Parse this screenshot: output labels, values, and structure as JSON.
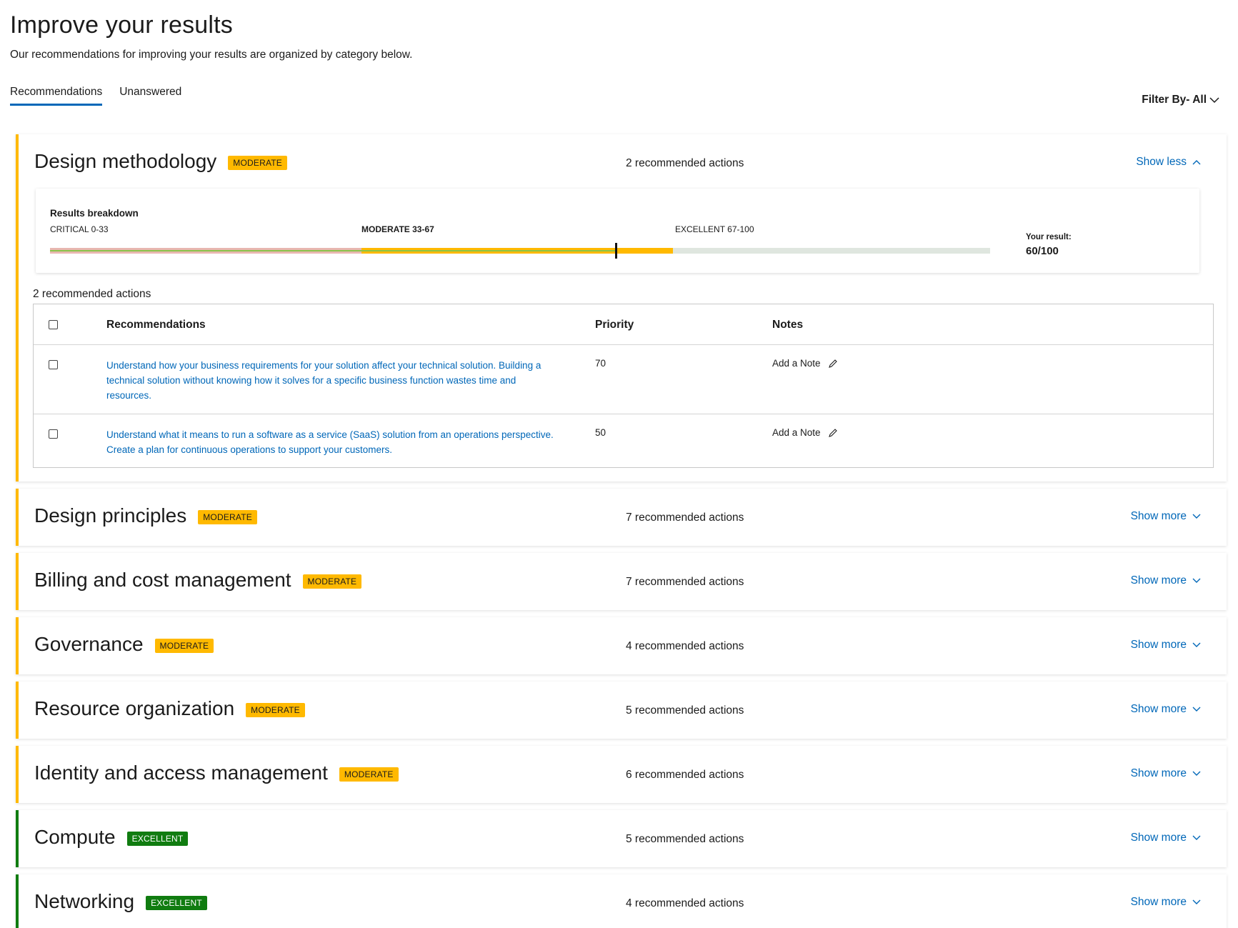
{
  "page": {
    "title": "Improve your results",
    "subtitle": "Our recommendations for improving your results are organized by category below."
  },
  "tabs": [
    {
      "label": "Recommendations",
      "active": true
    },
    {
      "label": "Unanswered",
      "active": false
    }
  ],
  "filter": {
    "label": "Filter By- All"
  },
  "colors": {
    "accent": "#0067b8",
    "moderate": "#ffb900",
    "excellent": "#107c10"
  },
  "categories": [
    {
      "name": "Design methodology",
      "badge": "MODERATE",
      "count": "2 recommended actions",
      "toggle": "Show less",
      "expanded": true,
      "breakdown": {
        "title": "Results breakdown",
        "ranges": [
          "CRITICAL 0-33",
          "MODERATE 33-67",
          "EXCELLENT 67-100"
        ],
        "result_label": "Your result:",
        "result_value": "60/100",
        "score": 60
      },
      "actions_label": "2 recommended actions",
      "table": {
        "headers": {
          "recommendations": "Recommendations",
          "priority": "Priority",
          "notes": "Notes"
        },
        "rows": [
          {
            "text": "Understand how your business requirements for your solution affect your technical solution. Building a technical solution without knowing how it solves for a specific business function wastes time and resources.",
            "priority": "70",
            "note": "Add a Note"
          },
          {
            "text": "Understand what it means to run a software as a service (SaaS) solution from an operations perspective. Create a plan for continuous operations to support your customers.",
            "priority": "50",
            "note": "Add a Note"
          }
        ]
      }
    },
    {
      "name": "Design principles",
      "badge": "MODERATE",
      "count": "7 recommended actions",
      "toggle": "Show more"
    },
    {
      "name": "Billing and cost management",
      "badge": "MODERATE",
      "count": "7 recommended actions",
      "toggle": "Show more"
    },
    {
      "name": "Governance",
      "badge": "MODERATE",
      "count": "4 recommended actions",
      "toggle": "Show more"
    },
    {
      "name": "Resource organization",
      "badge": "MODERATE",
      "count": "5 recommended actions",
      "toggle": "Show more"
    },
    {
      "name": "Identity and access management",
      "badge": "MODERATE",
      "count": "6 recommended actions",
      "toggle": "Show more"
    },
    {
      "name": "Compute",
      "badge": "EXCELLENT",
      "count": "5 recommended actions",
      "toggle": "Show more"
    },
    {
      "name": "Networking",
      "badge": "EXCELLENT",
      "count": "4 recommended actions",
      "toggle": "Show more"
    }
  ]
}
